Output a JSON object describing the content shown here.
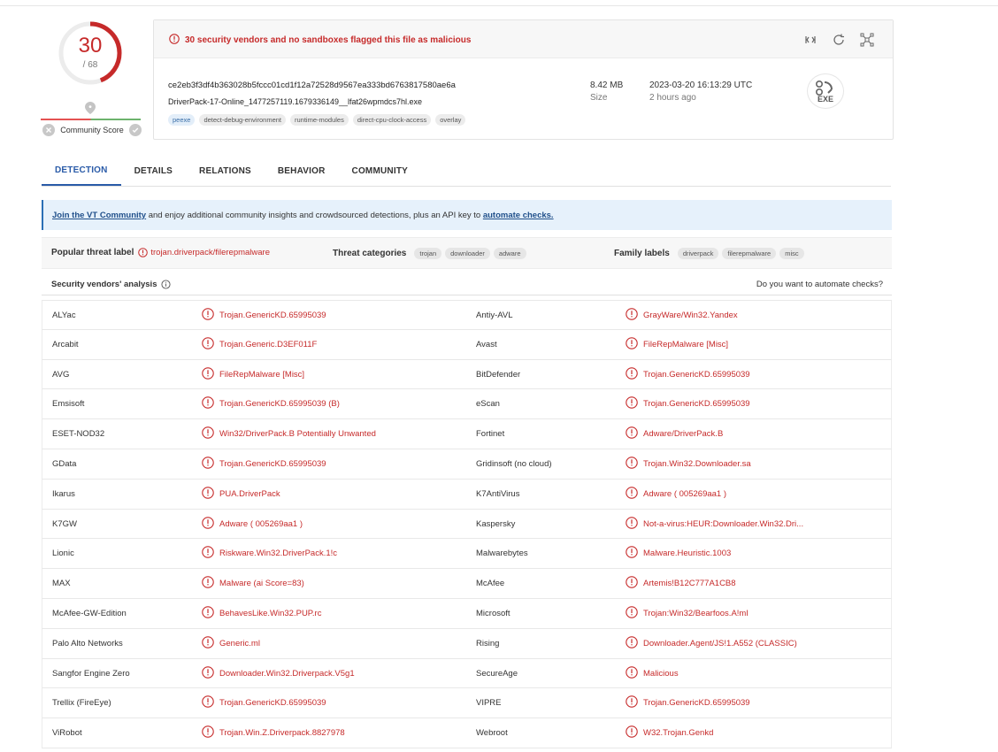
{
  "score": {
    "detections": "30",
    "total": "/ 68",
    "ratio": 0.441
  },
  "community": {
    "label": "Community Score"
  },
  "alert": {
    "text": "30 security vendors and no sandboxes flagged this file as malicious"
  },
  "file": {
    "hash": "ce2eb3f3df4b363028b5fccc01cd1f12a72528d9567ea333bd6763817580ae6a",
    "name": "DriverPack-17-Online_1477257119.1679336149__lfat26wpmdcs7hl.exe",
    "tags": [
      "peexe",
      "detect-debug-environment",
      "runtime-modules",
      "direct-cpu-clock-access",
      "overlay"
    ],
    "size": "8.42 MB",
    "size_label": "Size",
    "date": "2023-03-20 16:13:29 UTC",
    "date_ago": "2 hours ago",
    "type": "EXE"
  },
  "tabs": [
    "DETECTION",
    "DETAILS",
    "RELATIONS",
    "BEHAVIOR",
    "COMMUNITY"
  ],
  "banner": {
    "link1": "Join the VT Community",
    "middle": " and enjoy additional community insights and crowdsourced detections, plus an API key to ",
    "link2": "automate checks."
  },
  "threat": {
    "popular_label": "Popular threat label",
    "popular_value": "trojan.driverpack/filerepmalware",
    "categories_label": "Threat categories",
    "categories": [
      "trojan",
      "downloader",
      "adware"
    ],
    "family_label": "Family labels",
    "families": [
      "driverpack",
      "filerepmalware",
      "misc"
    ]
  },
  "vendors": {
    "title": "Security vendors' analysis",
    "automate_q": "Do you want to automate checks?",
    "rows": [
      [
        "ALYac",
        "Trojan.GenericKD.65995039",
        "Antiy-AVL",
        "GrayWare/Win32.Yandex"
      ],
      [
        "Arcabit",
        "Trojan.Generic.D3EF011F",
        "Avast",
        "FileRepMalware [Misc]"
      ],
      [
        "AVG",
        "FileRepMalware [Misc]",
        "BitDefender",
        "Trojan.GenericKD.65995039"
      ],
      [
        "Emsisoft",
        "Trojan.GenericKD.65995039 (B)",
        "eScan",
        "Trojan.GenericKD.65995039"
      ],
      [
        "ESET-NOD32",
        "Win32/DriverPack.B Potentially Unwanted",
        "Fortinet",
        "Adware/DriverPack.B"
      ],
      [
        "GData",
        "Trojan.GenericKD.65995039",
        "Gridinsoft (no cloud)",
        "Trojan.Win32.Downloader.sa"
      ],
      [
        "Ikarus",
        "PUA.DriverPack",
        "K7AntiVirus",
        "Adware ( 005269aa1 )"
      ],
      [
        "K7GW",
        "Adware ( 005269aa1 )",
        "Kaspersky",
        "Not-a-virus:HEUR:Downloader.Win32.Dri..."
      ],
      [
        "Lionic",
        "Riskware.Win32.DriverPack.1!c",
        "Malwarebytes",
        "Malware.Heuristic.1003"
      ],
      [
        "MAX",
        "Malware (ai Score=83)",
        "McAfee",
        "Artemis!B12C777A1CB8"
      ],
      [
        "McAfee-GW-Edition",
        "BehavesLike.Win32.PUP.rc",
        "Microsoft",
        "Trojan:Win32/Bearfoos.A!ml"
      ],
      [
        "Palo Alto Networks",
        "Generic.ml",
        "Rising",
        "Downloader.Agent/JS!1.A552 (CLASSIC)"
      ],
      [
        "Sangfor Engine Zero",
        "Downloader.Win32.Driverpack.V5g1",
        "SecureAge",
        "Malicious"
      ],
      [
        "Trellix (FireEye)",
        "Trojan.GenericKD.65995039",
        "VIPRE",
        "Trojan.GenericKD.65995039"
      ],
      [
        "ViRobot",
        "Trojan.Win.Z.Driverpack.8827978",
        "Webroot",
        "W32.Trojan.Genkd"
      ]
    ]
  }
}
